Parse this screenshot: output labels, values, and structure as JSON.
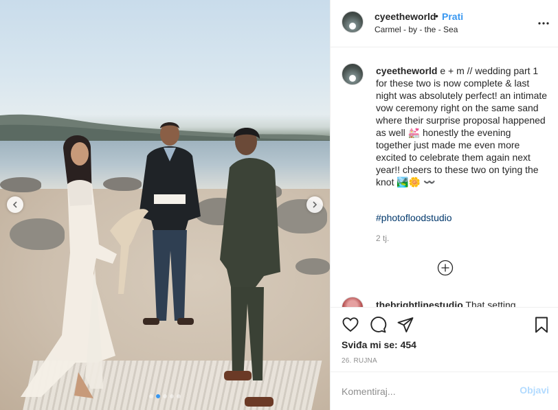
{
  "post": {
    "username": "cyeetheworld",
    "follow_separator": "•",
    "follow_label": "Prati",
    "location": "Carmel - by - the - Sea",
    "more_icon": "more-horizontal-icon"
  },
  "photo": {
    "alt_description": "",
    "carousel_count": 5,
    "carousel_active": 1
  },
  "caption": {
    "username": "cyeetheworld",
    "text": "e + m // wedding part 1 for these two is now complete & last night was absolutely perfect! an intimate vow ceremony right on the same sand where their surprise proposal happened as well 💒 honestly the evening together just made me even more excited to celebrate them again next year!! cheers to these two on tying the knot 🏞️🌼 〰️",
    "hashtag": "#photofloodstudio",
    "time_ago": "2 tj."
  },
  "next_comment": {
    "username": "thebrightlinestudio",
    "text": "That setting"
  },
  "actions": {
    "likes_label": "Sviđa mi se:",
    "likes_count": "454",
    "date": "26. rujna"
  },
  "composer": {
    "placeholder": "Komentiraj...",
    "post_label": "Objavi"
  },
  "colors": {
    "accent": "#3897f0",
    "hashtag": "#00376b",
    "muted": "#8e8e8e",
    "post_disabled": "#b3dbff"
  }
}
